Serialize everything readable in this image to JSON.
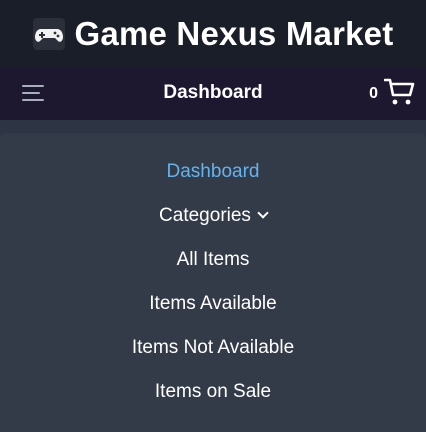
{
  "brand": {
    "title": "Game Nexus Market",
    "icon": "gamepad-icon"
  },
  "navbar": {
    "title": "Dashboard",
    "menu_icon": "hamburger-menu-icon",
    "cart_count": "0",
    "cart_icon": "shopping-cart-icon"
  },
  "menu": {
    "items": [
      {
        "label": "Dashboard",
        "active": true
      },
      {
        "label": "Categories",
        "has_dropdown": true
      },
      {
        "label": "All Items"
      },
      {
        "label": "Items Available"
      },
      {
        "label": "Items Not Available"
      },
      {
        "label": "Items on Sale"
      }
    ]
  },
  "colors": {
    "brand_bar": "#1a1e28",
    "navbar": "#1e1730",
    "menu_panel": "#333b49",
    "active_link": "#63b3ed",
    "text": "#ffffff"
  }
}
